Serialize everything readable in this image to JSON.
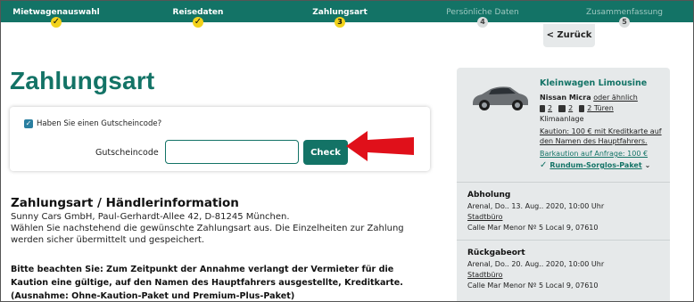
{
  "steps": [
    {
      "label": "Mietwagenauswahl",
      "marker": "✓",
      "state": "done"
    },
    {
      "label": "Reisedaten",
      "marker": "✓",
      "state": "done"
    },
    {
      "label": "Zahlungsart",
      "marker": "3",
      "state": "current"
    },
    {
      "label": "Persönliche Daten",
      "marker": "4",
      "state": "todo"
    },
    {
      "label": "Zusammenfassung",
      "marker": "5",
      "state": "todo"
    }
  ],
  "back_button": "< Zurück",
  "page_title": "Zahlungsart",
  "voucher": {
    "checkbox_checked": true,
    "checkbox_mark": "✓",
    "question": "Haben Sie einen Gutscheincode?",
    "code_label": "Gutscheincode",
    "code_value": "",
    "check_button": "Check"
  },
  "payment_info": {
    "title": "Zahlungsart / Händlerinformation",
    "lines": [
      "Sunny Cars GmbH, Paul-Gerhardt-Allee 42, D-81245 München.",
      "Wählen Sie nachstehend die gewünschte Zahlungsart aus. Die Einzelheiten zur Zahlung werden sicher übermittelt und gespeichert."
    ],
    "notice": "Bitte beachten Sie: Zum Zeitpunkt der Annahme verlangt der Vermieter für die Kaution eine gültige, auf den Namen des Hauptfahrers ausgestellte, Kreditkarte. (Ausnahme: Ohne-Kaution-Paket und Premium-Plus-Paket)"
  },
  "sidebar": {
    "car_title": "Kleinwagen Limousine",
    "car_model": "Nissan Micra",
    "car_model_suffix": "oder ähnlich",
    "specs": {
      "persons": "2",
      "bags": "2",
      "doors": "2 Türen"
    },
    "ac": "Klimaanlage",
    "deposit": "Kaution: 100 € mit Kreditkarte auf den Namen des Hauptfahrers.",
    "barkaution": "Barkaution auf Anfrage: 100 €",
    "package_check": "✓",
    "package": "Rundum-Sorglos-Paket",
    "package_chevron": "⌄",
    "pickup": {
      "heading": "Abholung",
      "datetime": "Arenal, Do.. 13. Aug.. 2020, 10:00 Uhr",
      "office": "Stadtbüro",
      "address": "Calle Mar Menor Nº 5 Local 9, 07610"
    },
    "return": {
      "heading": "Rückgabeort",
      "datetime": "Arenal, Do.. 20. Aug.. 2020, 10:00 Uhr",
      "office": "Stadtbüro",
      "address": "Calle Mar Menor Nº 5 Local 9, 07610"
    }
  },
  "colors": {
    "brand": "#137366",
    "step_marker": "#f2d21b",
    "arrow": "#e0101a",
    "sidebar_bg": "#e6e9ea"
  }
}
